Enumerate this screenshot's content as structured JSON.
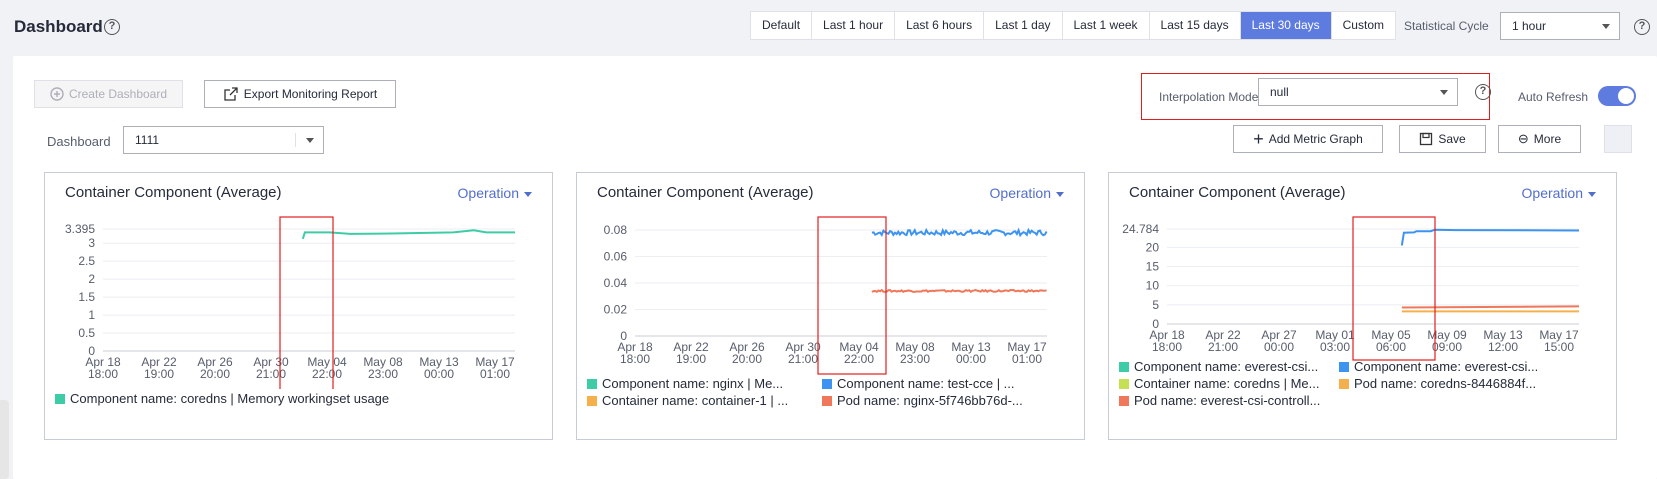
{
  "header": {
    "title": "Dashboard",
    "help": "?",
    "time_ranges": [
      {
        "label": "Default",
        "active": false
      },
      {
        "label": "Last 1 hour",
        "active": false
      },
      {
        "label": "Last 6 hours",
        "active": false
      },
      {
        "label": "Last 1 day",
        "active": false
      },
      {
        "label": "Last 1 week",
        "active": false
      },
      {
        "label": "Last 15 days",
        "active": false
      },
      {
        "label": "Last 30 days",
        "active": true
      },
      {
        "label": "Custom",
        "active": false
      }
    ],
    "statistical_cycle_label": "Statistical Cycle",
    "statistical_cycle_value": "1 hour"
  },
  "toolbar": {
    "create_dashboard": "Create Dashboard",
    "export_report": "Export Monitoring Report",
    "interpolation_label": "Interpolation Mode",
    "interpolation_value": "null",
    "auto_refresh_label": "Auto Refresh",
    "auto_refresh_on": true,
    "dashboard_label": "Dashboard",
    "dashboard_value": "1111",
    "add_metric": "Add Metric Graph",
    "save": "Save",
    "more": "More"
  },
  "colors": {
    "accent": "#5e7ce0",
    "highlight_box": "#e31d1d",
    "teal": "#3dcca6",
    "blue": "#3c94f0",
    "orange": "#f0785a",
    "amber": "#f5b04b",
    "lime": "#c5e052"
  },
  "chart_data": [
    {
      "type": "line",
      "title": "Container Component (Average)",
      "operation": "Operation",
      "yticks": [
        "3.395",
        "3",
        "2.5",
        "2",
        "1.5",
        "1",
        "0.5",
        "0"
      ],
      "ylim": [
        0,
        3.395
      ],
      "xticks": [
        [
          "Apr 18",
          "18:00"
        ],
        [
          "Apr 22",
          "19:00"
        ],
        [
          "Apr 26",
          "20:00"
        ],
        [
          "Apr 30",
          "21:00"
        ],
        [
          "May 04",
          "22:00"
        ],
        [
          "May 08",
          "23:00"
        ],
        [
          "May 13",
          "00:00"
        ],
        [
          "May 17",
          "01:00"
        ]
      ],
      "series": [
        {
          "name": "Component name: coredns | Memory workingset usage",
          "color": "#3dcca6",
          "points": [
            [
              0.485,
              3.12
            ],
            [
              0.49,
              3.3
            ],
            [
              0.55,
              3.3
            ],
            [
              0.6,
              3.26
            ],
            [
              0.7,
              3.27
            ],
            [
              0.85,
              3.3
            ],
            [
              0.9,
              3.36
            ],
            [
              0.93,
              3.3
            ],
            [
              1.0,
              3.3
            ]
          ]
        }
      ],
      "legend": [
        [
          "Component name: coredns | Memory workingset usage",
          "#3dcca6"
        ]
      ]
    },
    {
      "type": "line",
      "title": "Container Component (Average)",
      "operation": "Operation",
      "yticks": [
        "0.08",
        "0.06",
        "0.04",
        "0.02",
        "0"
      ],
      "ylim": [
        0,
        0.08
      ],
      "xticks": [
        [
          "Apr 18",
          "18:00"
        ],
        [
          "Apr 22",
          "19:00"
        ],
        [
          "Apr 26",
          "20:00"
        ],
        [
          "Apr 30",
          "21:00"
        ],
        [
          "May 04",
          "22:00"
        ],
        [
          "May 08",
          "23:00"
        ],
        [
          "May 13",
          "00:00"
        ],
        [
          "May 17",
          "01:00"
        ]
      ],
      "series": [
        {
          "name": "Component name: test-cce",
          "color": "#3c94f0",
          "start": 0.575,
          "level": 0.078,
          "noise": 0.002
        },
        {
          "name": "Pod name: nginx",
          "color": "#f0785a",
          "start": 0.575,
          "level": 0.034,
          "noise": 0.0007
        }
      ],
      "legend": [
        [
          "Component name: nginx | Me...",
          "#3dcca6"
        ],
        [
          "Component name: test-cce | ...",
          "#3c94f0"
        ],
        [
          "Container name: container-1 | ...",
          "#f5b04b"
        ],
        [
          "Pod name: nginx-5f746bb76d-...",
          "#f0785a"
        ]
      ]
    },
    {
      "type": "line",
      "title": "Container Component (Average)",
      "operation": "Operation",
      "yticks": [
        "24.784",
        "20",
        "15",
        "10",
        "5",
        "0"
      ],
      "ylim": [
        0,
        24.784
      ],
      "xticks": [
        [
          "Apr 18",
          "18:00"
        ],
        [
          "Apr 22",
          "21:00"
        ],
        [
          "Apr 27",
          "00:00"
        ],
        [
          "May 01",
          "03:00"
        ],
        [
          "May 05",
          "06:00"
        ],
        [
          "May 09",
          "09:00"
        ],
        [
          "May 13",
          "12:00"
        ],
        [
          "May 17",
          "15:00"
        ]
      ],
      "series": [
        {
          "name": "Component name: everest-csi",
          "color": "#3c94f0",
          "points": [
            [
              0.57,
              20.5
            ],
            [
              0.575,
              23.8
            ],
            [
              0.6,
              23.9
            ],
            [
              0.605,
              24.2
            ],
            [
              0.64,
              24.2
            ],
            [
              0.65,
              24.6
            ],
            [
              0.7,
              24.5
            ],
            [
              1.0,
              24.4
            ]
          ]
        },
        {
          "name": "Pod name: everest-csi-controll",
          "color": "#f0785a",
          "points": [
            [
              0.57,
              4.3
            ],
            [
              1.0,
              4.6
            ]
          ]
        },
        {
          "name": "Pod name: coredns-8446884f",
          "color": "#f5b04b",
          "points": [
            [
              0.57,
              3.3
            ],
            [
              1.0,
              3.3
            ]
          ]
        }
      ],
      "legend": [
        [
          "Component name: everest-csi...",
          "#3dcca6"
        ],
        [
          "Component name: everest-csi...",
          "#3c94f0"
        ],
        [
          "Container name: coredns | Me...",
          "#c5e052"
        ],
        [
          "Pod name: coredns-8446884f...",
          "#f5b04b"
        ],
        [
          "Pod name: everest-csi-controll...",
          "#f0785a"
        ]
      ]
    }
  ]
}
